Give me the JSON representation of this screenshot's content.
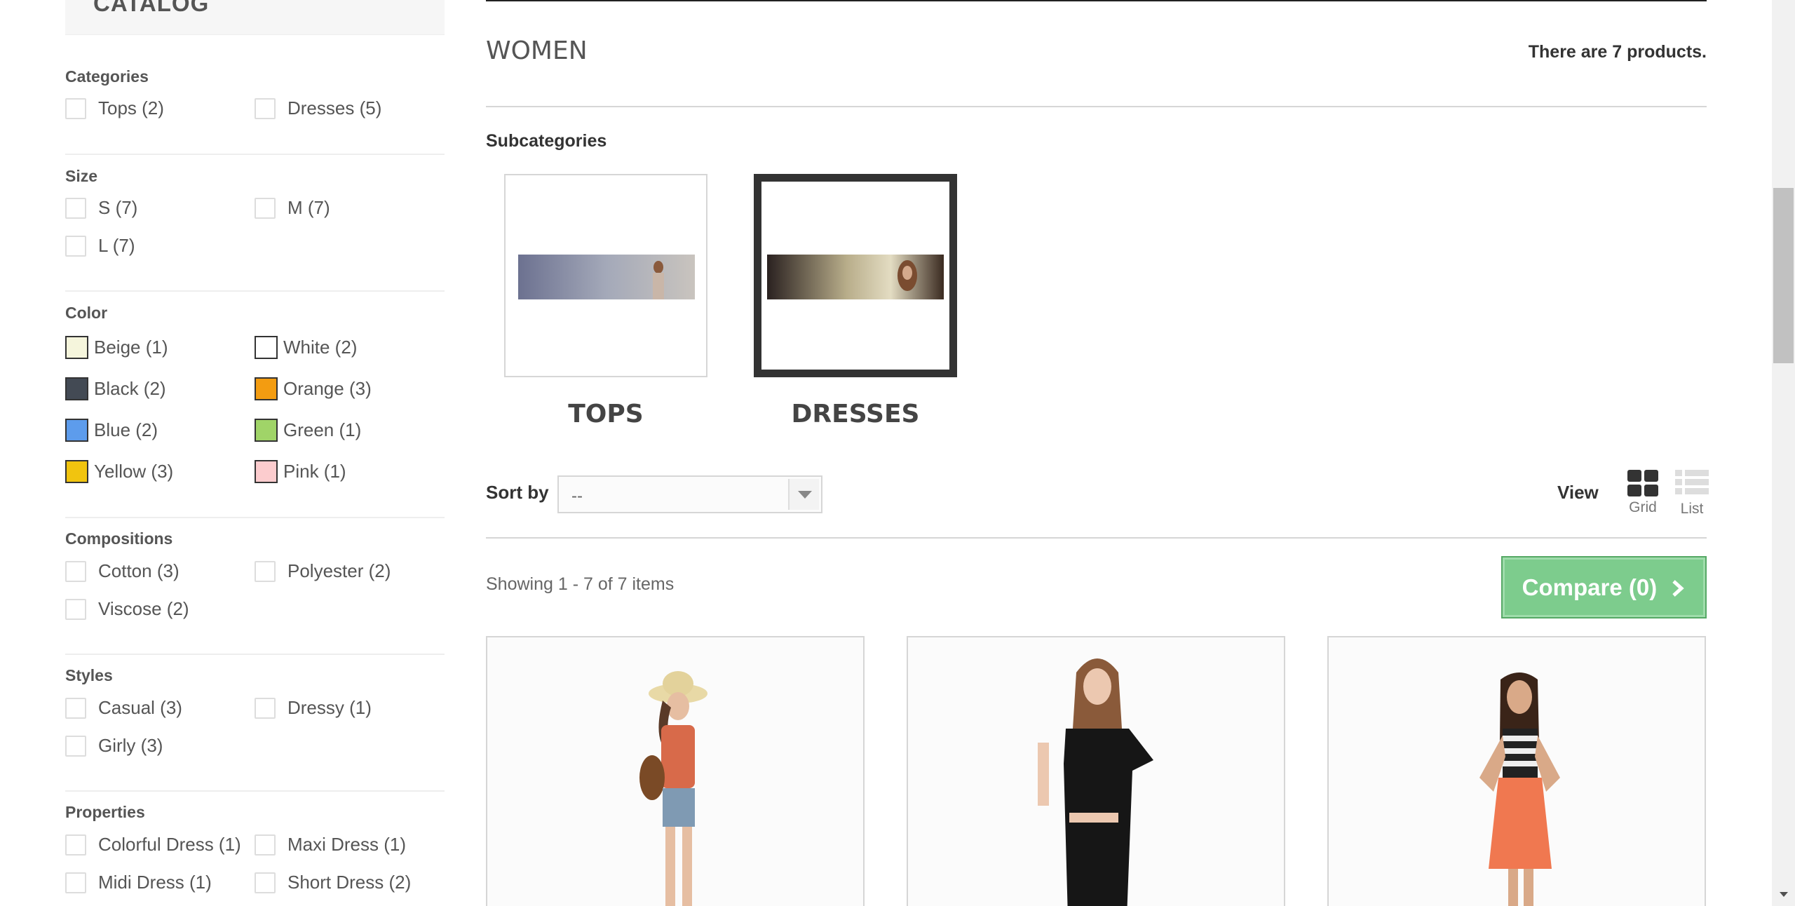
{
  "sidebar": {
    "catalog_title": "CATALOG",
    "filters": [
      {
        "title": "Categories",
        "options": [
          "Tops (2)",
          "Dresses (5)"
        ]
      },
      {
        "title": "Size",
        "options": [
          "S (7)",
          "M (7)",
          "L (7)"
        ]
      },
      {
        "title": "Color",
        "options": [
          {
            "label": "Beige (1)",
            "color": "#f5f5dc"
          },
          {
            "label": "White (2)",
            "color": "#ffffff"
          },
          {
            "label": "Black (2)",
            "color": "#434a54"
          },
          {
            "label": "Orange (3)",
            "color": "#f39c11"
          },
          {
            "label": "Blue (2)",
            "color": "#5d9cec"
          },
          {
            "label": "Green (1)",
            "color": "#a0d468"
          },
          {
            "label": "Yellow (3)",
            "color": "#f1c40f"
          },
          {
            "label": "Pink (1)",
            "color": "#fcccce"
          }
        ]
      },
      {
        "title": "Compositions",
        "options": [
          "Cotton (3)",
          "Polyester (2)",
          "Viscose (2)"
        ]
      },
      {
        "title": "Styles",
        "options": [
          "Casual (3)",
          "Dressy (1)",
          "Girly (3)"
        ]
      },
      {
        "title": "Properties",
        "options": [
          "Colorful Dress (1)",
          "Maxi Dress (1)",
          "Midi Dress (1)",
          "Short Dress (2)"
        ]
      }
    ]
  },
  "main": {
    "category_title": "WOMEN",
    "product_count": "There are 7 products.",
    "subcategories_title": "Subcategories",
    "subcategories": [
      {
        "name": "TOPS",
        "active": false
      },
      {
        "name": "DRESSES",
        "active": true
      }
    ],
    "sort": {
      "label": "Sort by",
      "value": "--"
    },
    "view": {
      "label": "View",
      "grid": "Grid",
      "list": "List"
    },
    "showing": "Showing 1 - 7 of 7 items",
    "compare_button": "Compare (0)"
  },
  "colors": {
    "accent_green": "#7dcc8d",
    "text_dark": "#333333",
    "border": "#d6d6d6"
  }
}
